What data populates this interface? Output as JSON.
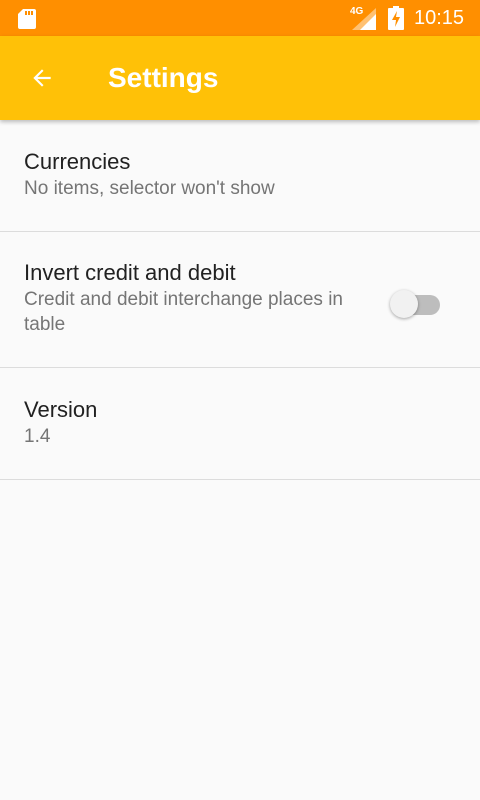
{
  "status_bar": {
    "network": "4G",
    "time": "10:15",
    "icons": [
      "sd-card-icon",
      "signal-icon",
      "battery-charging-icon"
    ]
  },
  "app_bar": {
    "title": "Settings",
    "back_icon": "arrow-back-icon"
  },
  "settings": {
    "items": [
      {
        "title": "Currencies",
        "summary": "No items, selector won't show"
      },
      {
        "title": "Invert credit and debit",
        "summary": "Credit and debit interchange places in table",
        "toggle_on": false
      },
      {
        "title": "Version",
        "summary": "1.4"
      }
    ]
  },
  "colors": {
    "status_bar": "#ff8f00",
    "app_bar": "#ffc107",
    "background": "#fafafa",
    "title_text": "#212121",
    "summary_text": "#757575"
  }
}
